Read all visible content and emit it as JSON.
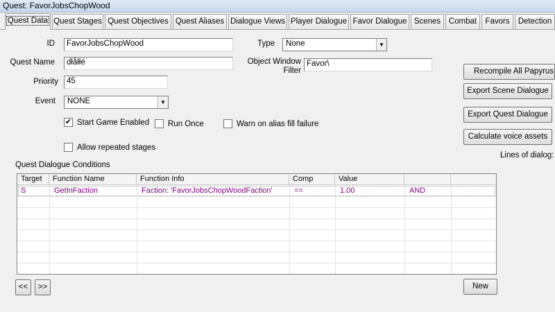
{
  "window": {
    "title": "Quest: FavorJobsChopWood"
  },
  "tabs": [
    "Quest Data",
    "Quest Stages",
    "Quest Objectives",
    "Quest Aliases",
    "Dialogue Views",
    "Player Dialogue",
    "Favor Dialogue",
    "Scenes",
    "Combat",
    "Favors",
    "Detection"
  ],
  "form": {
    "id_label": "ID",
    "id_value": "FavorJobsChopWood",
    "quest_name_label": "Quest Name",
    "quest_name_value": "dłåłłé",
    "priority_label": "Priority",
    "priority_value": "45",
    "event_label": "Event",
    "event_value": "NONE",
    "type_label": "Type",
    "type_value": "None",
    "owf_label_1": "Object Window",
    "owf_label_2": "Filter",
    "owf_value": "Favor\\"
  },
  "checkboxes": {
    "start_game_enabled": {
      "label": "Start Game Enabled",
      "checked": true
    },
    "run_once": {
      "label": "Run Once",
      "checked": false
    },
    "warn_alias": {
      "label": "Warn on alias fill failure",
      "checked": false
    },
    "allow_repeated": {
      "label": "Allow repeated stages",
      "checked": false
    }
  },
  "side": {
    "recompile": "Recompile All Papyrus Sc",
    "export_scene": "Export Scene Dialogue",
    "export_quest": "Export Quest Dialogue",
    "calc_voice": "Calculate voice assets",
    "lines_of_dialog": "Lines of dialog:"
  },
  "conditions": {
    "title": "Quest Dialogue Conditions",
    "headers": [
      "Target",
      "Function Name",
      "Function Info",
      "Comp",
      "Value",
      ""
    ],
    "rows": [
      [
        "S",
        "GetInFaction",
        "Faction: 'FavorJobsChopWoodFaction'",
        "==",
        "1.00",
        "AND"
      ]
    ]
  },
  "nav": {
    "prev": "<<",
    "next": ">>",
    "new": "New"
  }
}
